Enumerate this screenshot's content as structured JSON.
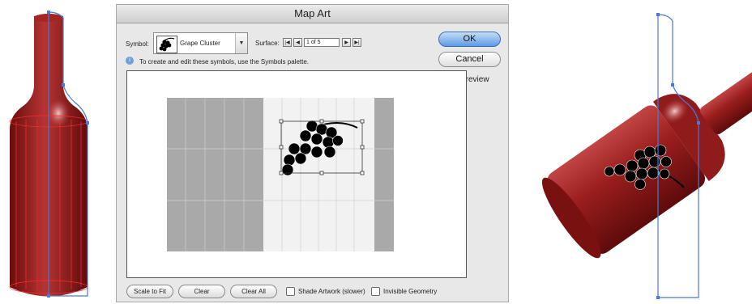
{
  "dialog": {
    "title": "Map Art",
    "symbol_label": "Symbol:",
    "symbol_value": "Grape Cluster",
    "surface_label": "Surface:",
    "surface_value": "1 of 5",
    "ok_label": "OK",
    "cancel_label": "Cancel",
    "preview_label": "Preview",
    "preview_checked": true,
    "info_text": "To create and edit these symbols, use the Symbols palette.",
    "scale_to_fit_label": "Scale to Fit",
    "clear_label": "Clear",
    "clear_all_label": "Clear All",
    "shade_artwork_label": "Shade Artwork (slower)",
    "shade_artwork_checked": false,
    "invisible_geometry_label": "Invisible Geometry",
    "invisible_geometry_checked": false
  },
  "icons": {
    "first": "first-page-icon",
    "prev": "previous-page-icon",
    "next": "next-page-icon",
    "last": "last-page-icon",
    "info": "info-icon",
    "symbol": "grape-cluster-icon"
  },
  "colors": {
    "wine": "#8b1a1a",
    "guide": "#4a78d6",
    "ok_button": "#5d9be4"
  }
}
